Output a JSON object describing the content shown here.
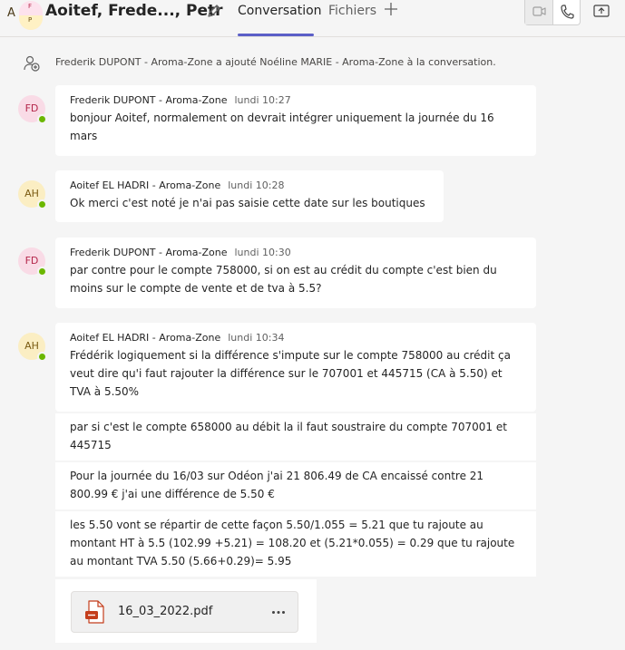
{
  "header": {
    "avatar_initial": "A",
    "avatar_sub_top": "F",
    "avatar_sub_bottom": "P",
    "title": "Aoitef, Frede..., Petr",
    "tabs": [
      {
        "label": "Conversation",
        "active": true
      },
      {
        "label": "Fichiers",
        "active": false
      }
    ]
  },
  "system_message": "Frederik DUPONT - Aroma-Zone a ajouté Noéline MARIE - Aroma-Zone à la conversation.",
  "messages": [
    {
      "initials": "FD",
      "sender": "Frederik DUPONT - Aroma-Zone",
      "time": "lundi 10:27",
      "lines": [
        "bonjour Aoitef, normalement on devrait intégrer uniquement la journée du 16",
        "mars"
      ]
    },
    {
      "initials": "AH",
      "sender": "Aoitef EL HADRI - Aroma-Zone",
      "time": "lundi 10:28",
      "lines": [
        "Ok merci c'est noté je n'ai pas saisie cette date sur les boutiques"
      ]
    },
    {
      "initials": "FD",
      "sender": "Frederik DUPONT - Aroma-Zone",
      "time": "lundi 10:30",
      "lines": [
        "par contre pour le compte 758000, si on est au crédit du compte c'est bien du",
        "moins sur le compte de vente et de tva à 5.5?"
      ]
    },
    {
      "initials": "AH",
      "sender": "Aoitef EL HADRI - Aroma-Zone",
      "time": "lundi 10:34",
      "lines": [
        "Frédérik logiquement si la différence s'impute sur le compte 758000 au crédit ça",
        "veut dire qu'i faut rajouter la différence sur le 707001 et 445715 (CA à 5.50) et",
        "TVA à 5.50%"
      ]
    }
  ],
  "continuations": [
    {
      "lines": [
        "par si c'est le compte 658000 au débit la il faut soustraire du compte 707001 et",
        "445715"
      ]
    },
    {
      "lines": [
        "Pour la journée du 16/03 sur Odéon j'ai 21 806.49 de CA encaissé contre 21",
        "800.99 € j'ai une différence de 5.50 €"
      ]
    },
    {
      "lines": [
        "les 5.50 vont se répartir de cette façon 5.50/1.055 = 5.21 que tu rajoute au",
        "montant HT à 5.5 (102.99 +5.21) = 108.20 et (5.21*0.055) = 0.29 que tu rajoute",
        "au montant TVA 5.50 (5.66+0.29)= 5.95"
      ]
    }
  ],
  "attachment": {
    "filename": "16_03_2022.pdf",
    "icon": "pdf-file-icon"
  },
  "colors": {
    "accent": "#5b5fc7",
    "presence_available": "#6bb700",
    "background": "#f5f5f5",
    "bubble": "#ffffff"
  }
}
